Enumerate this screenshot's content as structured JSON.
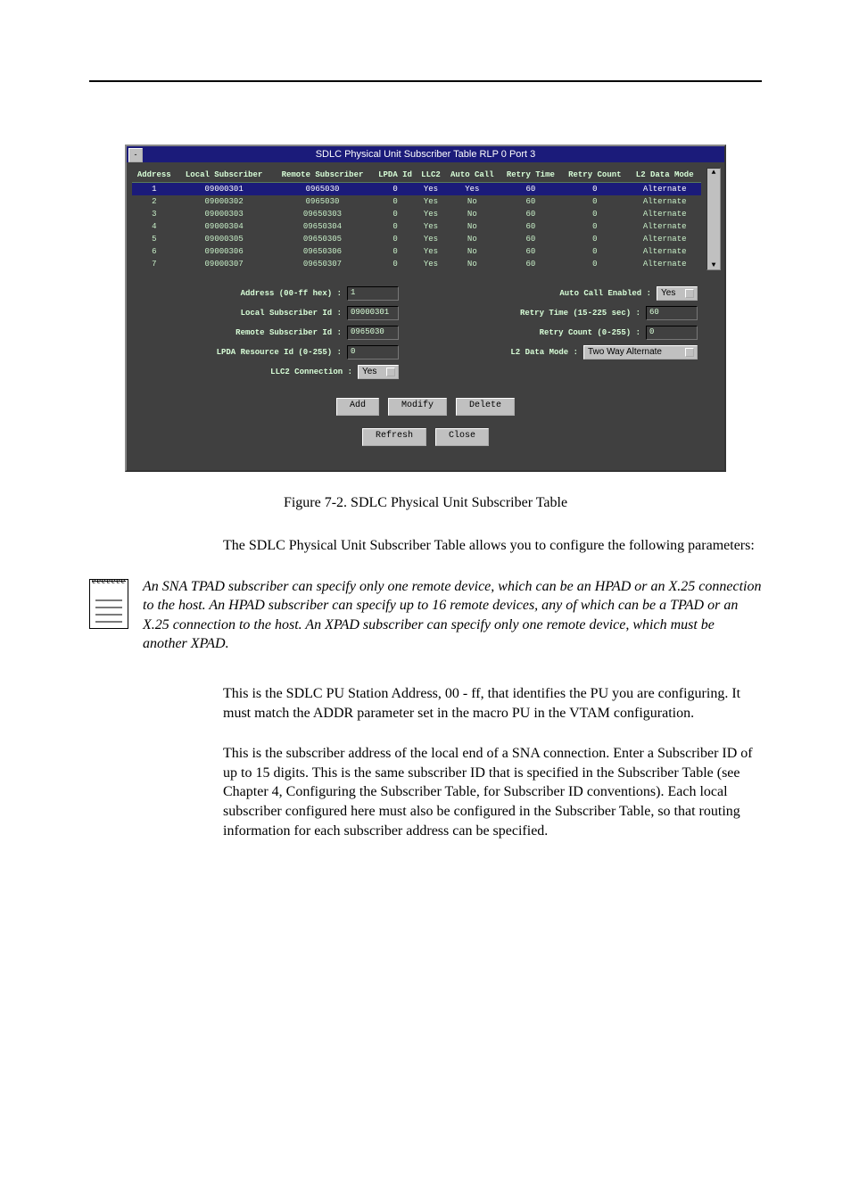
{
  "window": {
    "title": "SDLC Physical Unit Subscriber Table RLP 0 Port 3",
    "columns": [
      "Address",
      "Local Subscriber",
      "Remote Subscriber",
      "LPDA Id",
      "LLC2",
      "Auto Call",
      "Retry Time",
      "Retry Count",
      "L2 Data Mode"
    ],
    "rows": [
      {
        "addr": "1",
        "local": "09000301",
        "remote": "0965030",
        "lpda": "0",
        "llc2": "Yes",
        "auto": "Yes",
        "rtime": "60",
        "rcount": "0",
        "mode": "Alternate",
        "selected": true
      },
      {
        "addr": "2",
        "local": "09000302",
        "remote": "0965030",
        "lpda": "0",
        "llc2": "Yes",
        "auto": "No",
        "rtime": "60",
        "rcount": "0",
        "mode": "Alternate"
      },
      {
        "addr": "3",
        "local": "09000303",
        "remote": "09650303",
        "lpda": "0",
        "llc2": "Yes",
        "auto": "No",
        "rtime": "60",
        "rcount": "0",
        "mode": "Alternate"
      },
      {
        "addr": "4",
        "local": "09000304",
        "remote": "09650304",
        "lpda": "0",
        "llc2": "Yes",
        "auto": "No",
        "rtime": "60",
        "rcount": "0",
        "mode": "Alternate"
      },
      {
        "addr": "5",
        "local": "09000305",
        "remote": "09650305",
        "lpda": "0",
        "llc2": "Yes",
        "auto": "No",
        "rtime": "60",
        "rcount": "0",
        "mode": "Alternate"
      },
      {
        "addr": "6",
        "local": "09000306",
        "remote": "09650306",
        "lpda": "0",
        "llc2": "Yes",
        "auto": "No",
        "rtime": "60",
        "rcount": "0",
        "mode": "Alternate"
      },
      {
        "addr": "7",
        "local": "09000307",
        "remote": "09650307",
        "lpda": "0",
        "llc2": "Yes",
        "auto": "No",
        "rtime": "60",
        "rcount": "0",
        "mode": "Alternate"
      }
    ],
    "formLeft": {
      "address_label": "Address (00-ff hex) :",
      "address_value": "1",
      "local_label": "Local Subscriber Id :",
      "local_value": "09000301",
      "remote_label": "Remote Subscriber Id :",
      "remote_value": "0965030",
      "lpda_label": "LPDA Resource Id (0-255) :",
      "lpda_value": "0",
      "llc2_label": "LLC2 Connection :",
      "llc2_value": "Yes"
    },
    "formRight": {
      "auto_label": "Auto Call Enabled :",
      "auto_value": "Yes",
      "rtime_label": "Retry Time (15-225 sec) :",
      "rtime_value": "60",
      "rcount_label": "Retry Count (0-255) :",
      "rcount_value": "0",
      "mode_label": "L2 Data Mode :",
      "mode_value": "Two Way Alternate"
    },
    "buttons": {
      "add": "Add",
      "modify": "Modify",
      "delete": "Delete",
      "refresh": "Refresh",
      "close": "Close"
    }
  },
  "caption": "Figure 7-2.  SDLC Physical Unit Subscriber Table",
  "intro": "The SDLC Physical Unit Subscriber Table allows you to configure the following parameters:",
  "note": "An SNA TPAD subscriber can specify only one remote device, which can be an HPAD or an X.25 connection to the host. An HPAD subscriber can specify up to 16 remote devices, any of which can be a TPAD or an X.25 connection to the host. An XPAD subscriber can specify only one remote device, which must be another XPAD.",
  "para1": "This is the SDLC PU Station Address, 00 - ff, that identifies the PU you are configuring. It must match the ADDR parameter set in the macro PU in the VTAM configuration.",
  "para2": "This is the subscriber address of the local end of a SNA connection. Enter a Subscriber ID of up to 15 digits. This is the same subscriber ID that is specified in the Subscriber Table (see Chapter 4, Configuring the Subscriber Table, for Subscriber ID conventions). Each local subscriber configured here must also be configured in the Subscriber Table, so that routing information for each subscriber address can be specified."
}
